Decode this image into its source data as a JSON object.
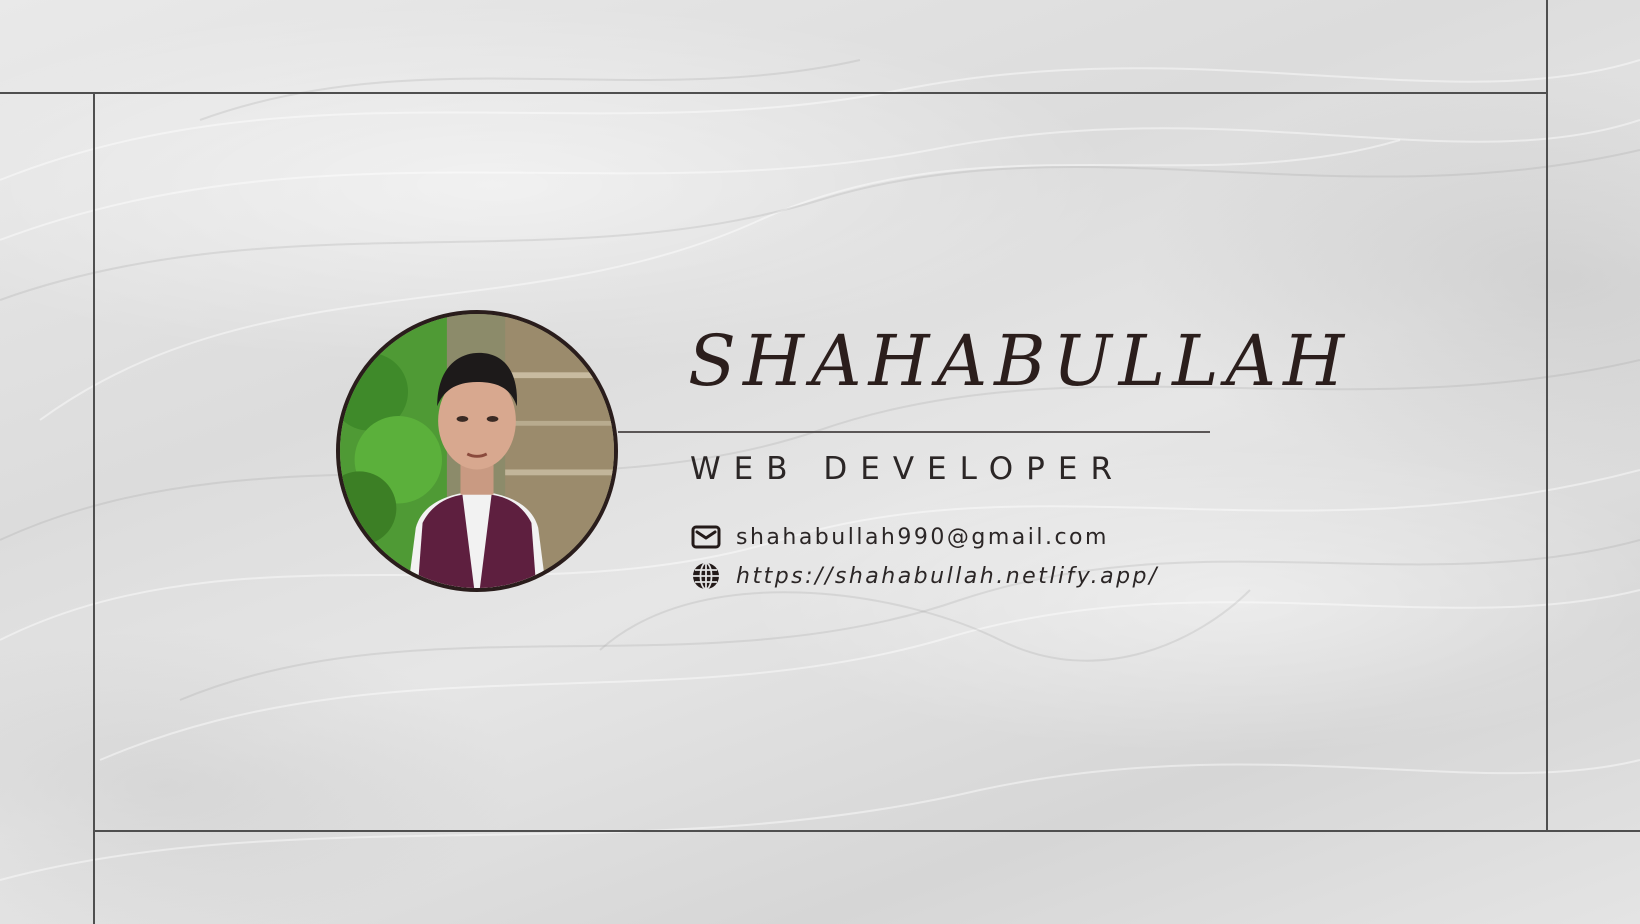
{
  "profile": {
    "name": "SHAHABULLAH",
    "role": "WEB DEVELOPER",
    "photo_icon": "profile-photo"
  },
  "contacts": {
    "email": {
      "icon": "mail-icon",
      "text": "shahabullah990@gmail.com"
    },
    "website": {
      "icon": "globe-icon",
      "text": "https://shahabullah.netlify.app/"
    }
  },
  "colors": {
    "text_dark": "#2b1e1c",
    "frame_line": "#4f4f4f",
    "vest": "#5e1f3f",
    "background": "#e3e3e3"
  }
}
